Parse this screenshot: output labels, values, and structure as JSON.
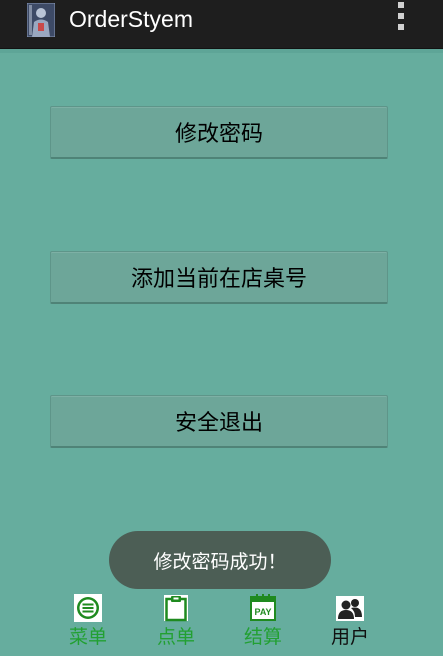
{
  "app": {
    "title": "OrderStyem",
    "icon": "app-person-icon",
    "overflow_icon": "more-vert-icon"
  },
  "buttons": [
    {
      "label": "修改密码"
    },
    {
      "label": "添加当前在店桌号"
    },
    {
      "label": "安全退出"
    }
  ],
  "toast": {
    "message": "修改密码成功！"
  },
  "tabs": [
    {
      "label": "菜单",
      "icon": "list-icon",
      "selected": false
    },
    {
      "label": "点单",
      "icon": "clipboard-icon",
      "selected": false
    },
    {
      "label": "结算",
      "icon": "pay-icon",
      "icon_text": "PAY",
      "selected": false
    },
    {
      "label": "用户",
      "icon": "users-icon",
      "selected": true
    }
  ],
  "colors": {
    "background": "#66ad9e",
    "action_bar": "#1e1e1e",
    "tab_label_active": "#111111",
    "tab_label_inactive": "#22a032",
    "tab_icon_green": "#1f8a1f"
  }
}
